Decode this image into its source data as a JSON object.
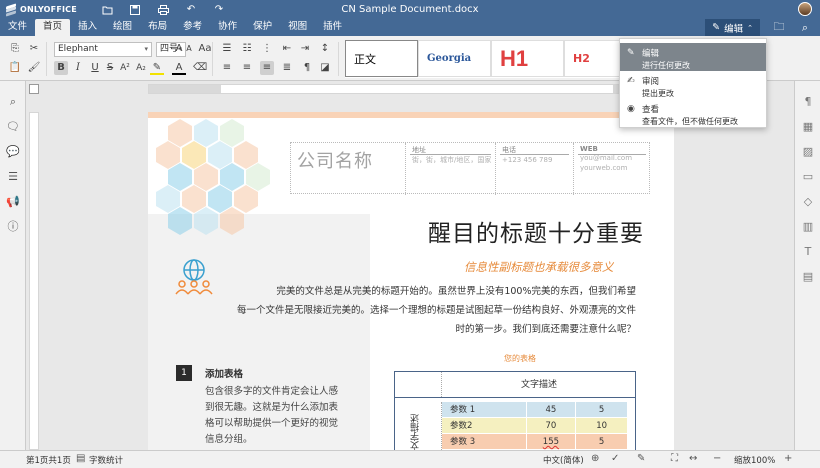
{
  "app": {
    "brand": "ONLYOFFICE",
    "doc_title": "CN Sample Document.docx"
  },
  "menu": {
    "tabs": [
      "文件",
      "首页",
      "插入",
      "绘图",
      "布局",
      "参考",
      "协作",
      "保护",
      "视图",
      "插件"
    ],
    "active_tab": "首页",
    "edit_button": "编辑"
  },
  "toolbar": {
    "font_name": "Elephant",
    "font_size": "四号",
    "styles": [
      "正文",
      "Georgia",
      "H1",
      "H2"
    ]
  },
  "mode_menu": {
    "items": [
      {
        "title": "编辑",
        "desc": "进行任何更改",
        "icon": "pencil-icon"
      },
      {
        "title": "审阅",
        "desc": "提出更改",
        "icon": "review-icon"
      },
      {
        "title": "查看",
        "desc": "查看文件，但不做任何更改",
        "icon": "eye-icon"
      }
    ]
  },
  "document": {
    "company_name": "公司名称",
    "address_label": "地址",
    "address_value": "街，街，城市/地区，国家",
    "phone_label": "电话",
    "phone_value": "+123 456 789",
    "web_label": "WEB",
    "web_email": "you@mail.com",
    "web_site": "yourweb.com",
    "title": "醒目的标题十分重要",
    "subtitle": "信息性副标题也承载很多意义",
    "paragraph_lines": [
      "完美的文件总是从完美的标题开始的。虽然世界上没有100%完美的东西，但我们希望",
      "每一个文件是无限接近完美的。选择一个理想的标题是试图起草一份结构良好、外观漂亮的文件",
      "时的第一步。我们到底还需要注意什么呢？"
    ],
    "section_number": "1",
    "section_title": "添加表格",
    "section_body": "包含很多字的文件肯定会让人感到很无趣。这就是为什么添加表格可以帮助提供一个更好的视觉信息分组。",
    "table_caption": "您的表格",
    "table_header": "文字描述",
    "table_side_label": "文字描述",
    "table_rows": [
      {
        "name": "参数 1",
        "a": "45",
        "b": "5"
      },
      {
        "name": "参数2",
        "a": "70",
        "b": "10"
      },
      {
        "name": "参数 3",
        "a": "155",
        "b": "5"
      }
    ]
  },
  "status": {
    "page_info": "第1页共1页",
    "word_count": "字数统计",
    "language": "中文(简体)",
    "zoom": "缩放100%"
  },
  "colors": {
    "header": "#446995",
    "accent_orange": "#e68a3a",
    "heading_red": "#e04040"
  }
}
